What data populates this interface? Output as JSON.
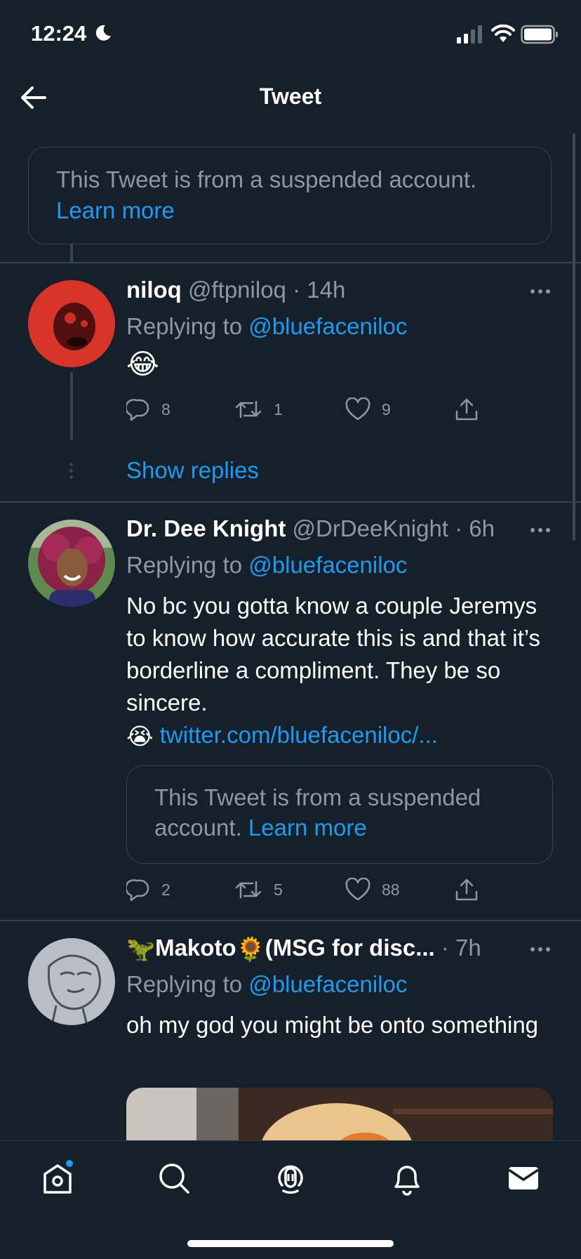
{
  "status_bar": {
    "time": "12:24"
  },
  "nav": {
    "title": "Tweet"
  },
  "suspended_notice": {
    "text": "This Tweet is from a suspended account.",
    "link": "Learn more"
  },
  "tweets": [
    {
      "name": "niloq",
      "handle": "@ftpniloq",
      "time": "14h",
      "replying_prefix": "Replying to ",
      "replying_handle": "@bluefaceniloc",
      "body": "😂",
      "replies": "8",
      "retweets": "1",
      "likes": "9",
      "show_replies": "Show replies"
    },
    {
      "name": "Dr. Dee Knight",
      "handle": "@DrDeeKnight",
      "time": "6h",
      "replying_prefix": "Replying to ",
      "replying_handle": "@bluefaceniloc",
      "body": "No bc you gotta know a couple Jeremys to know how accurate this is and that it’s borderline a compliment. They be so sincere.",
      "body_emoji": "😭",
      "body_link": "twitter.com/bluefaceniloc/...",
      "quote_text": "This Tweet is from a suspended account.",
      "quote_link": "Learn more",
      "replies": "2",
      "retweets": "5",
      "likes": "88"
    },
    {
      "name_prefix_emoji": "🦖",
      "name": "Makoto",
      "name_mid_emoji": "🌻",
      "name_suffix": "(MSG for disc...",
      "time": "7h",
      "replying_prefix": "Replying to ",
      "replying_handle": "@bluefaceniloc",
      "body": "oh my god you might be onto something"
    }
  ],
  "colors": {
    "background": "#15202b",
    "accent": "#1d9bf0",
    "muted": "#8b98a5",
    "border": "#38444d"
  },
  "tabbar": {
    "items": [
      "home-icon",
      "search-icon",
      "spaces-icon",
      "notifications-icon",
      "messages-icon"
    ]
  }
}
